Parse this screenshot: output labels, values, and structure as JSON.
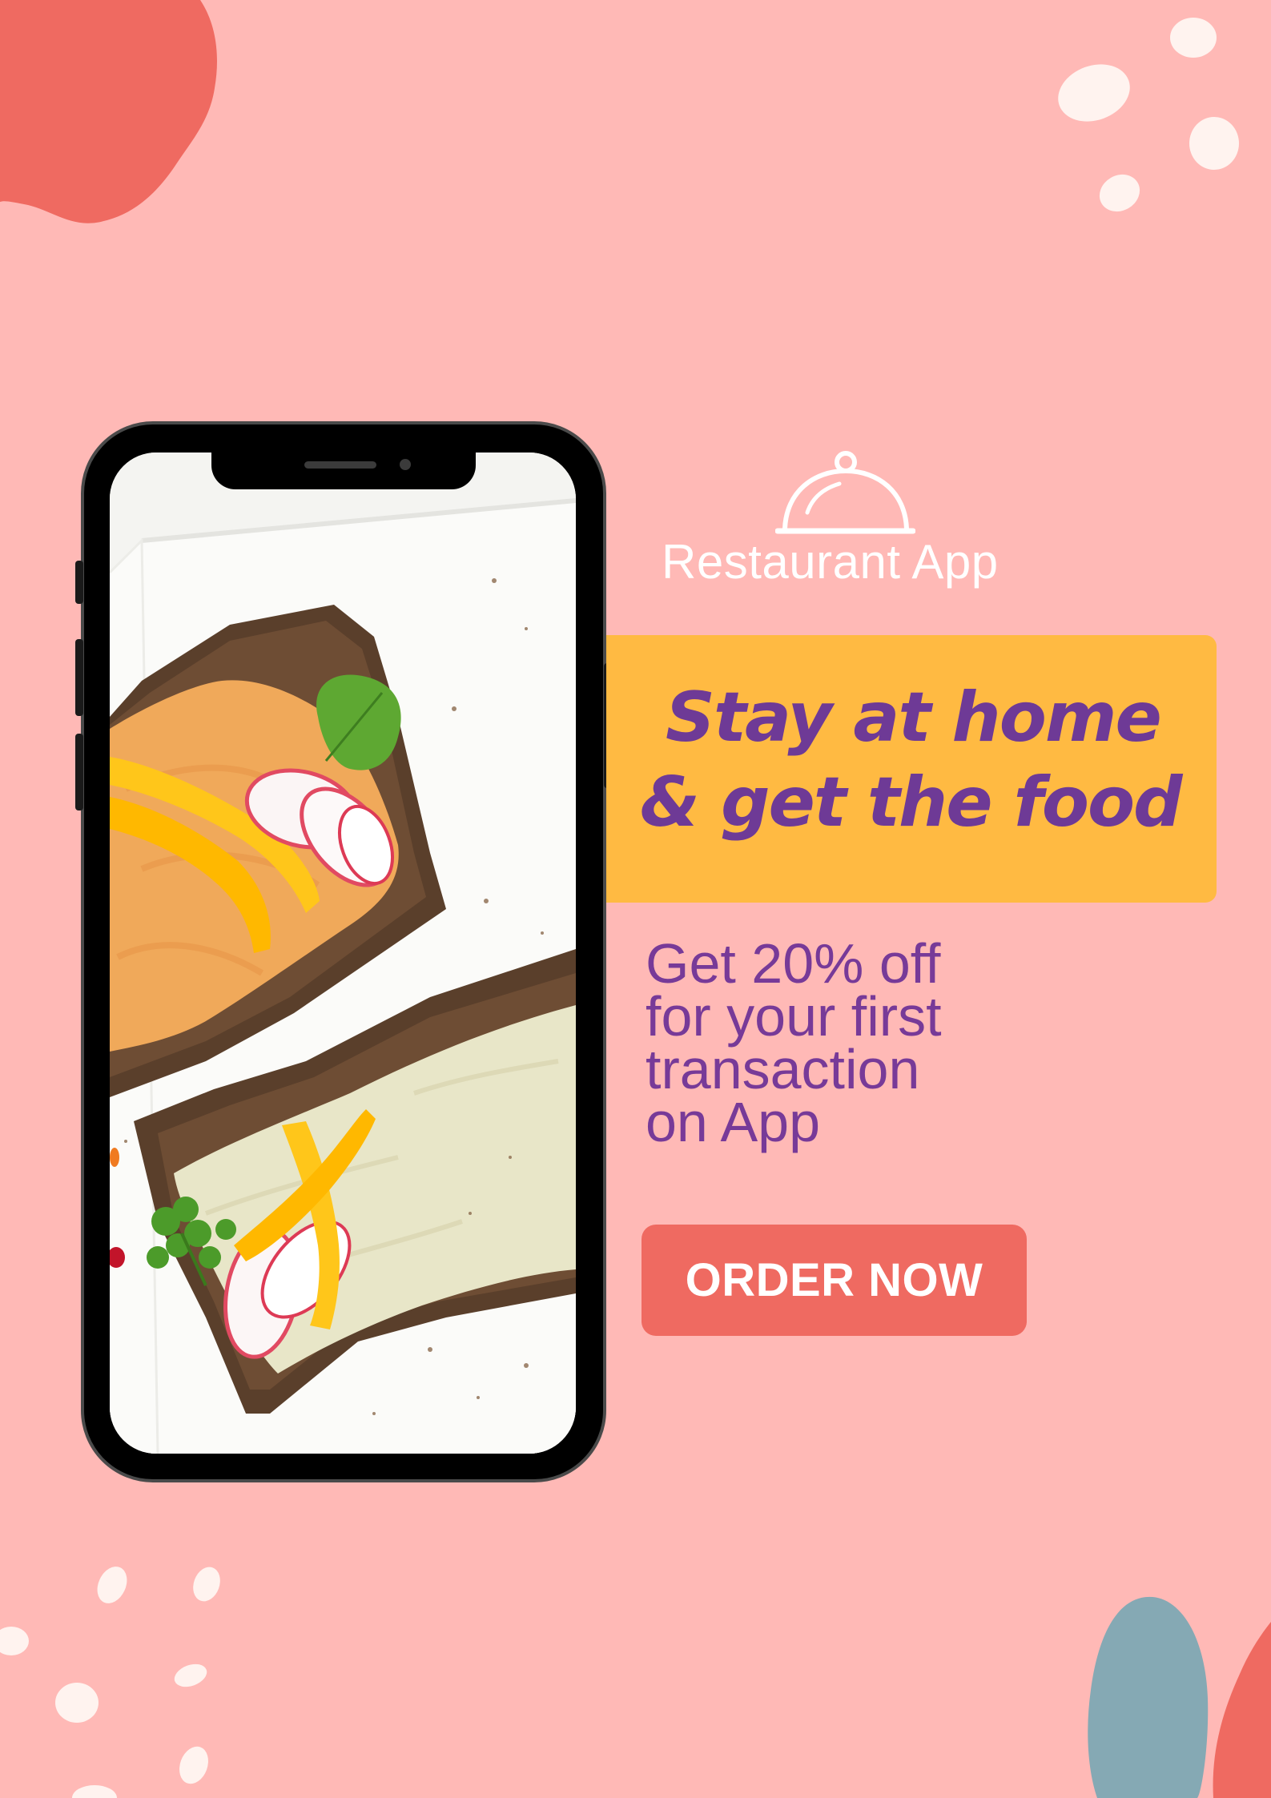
{
  "brand": {
    "name": "Restaurant App",
    "icon": "cloche-icon"
  },
  "headline": {
    "line1": "Stay at home",
    "line2": "& get the food"
  },
  "offer": {
    "lines": [
      "Get 20% off",
      "for your first",
      "transaction",
      "on App"
    ]
  },
  "cta": {
    "label": "ORDER NOW"
  },
  "phone": {
    "screen_image": "open-faced-hummus-toast-photo"
  },
  "colors": {
    "background": "#ffb9b6",
    "headline_box": "#ffba42",
    "headline_text": "#6e3a96",
    "offer_text": "#773a98",
    "button": "#ef6a61",
    "blob_coral": "#ef6a61",
    "blob_teal": "#85a9b4"
  }
}
